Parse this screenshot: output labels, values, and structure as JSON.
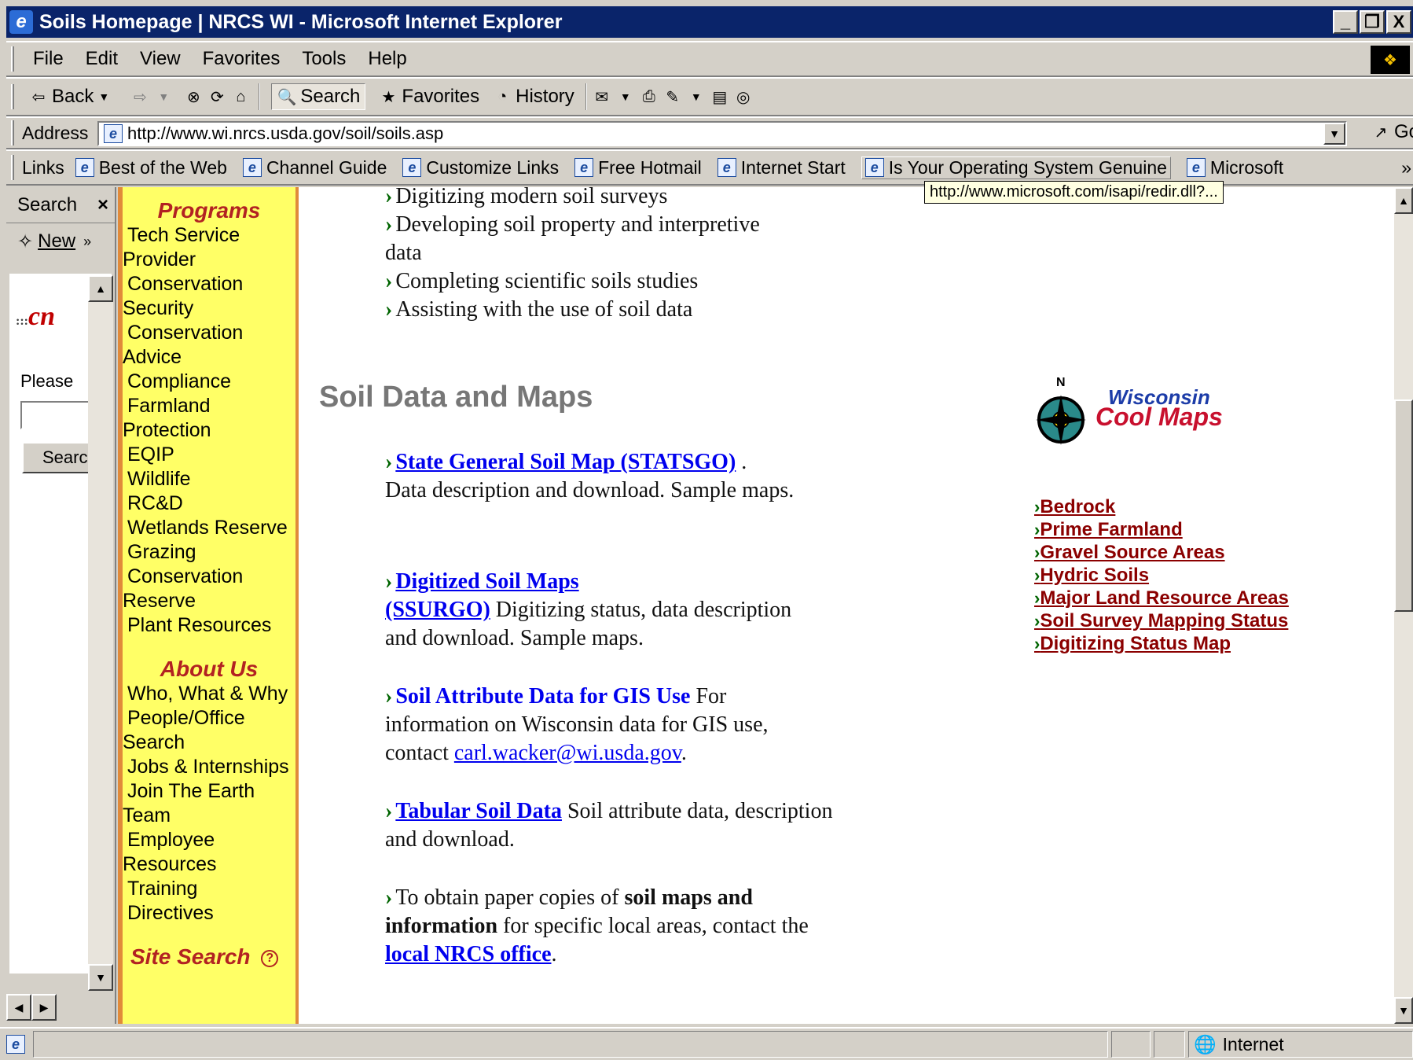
{
  "window": {
    "title": "Soils Homepage | NRCS WI - Microsoft Internet Explorer",
    "controls": [
      "_",
      "▫",
      "X"
    ]
  },
  "menu": [
    "File",
    "Edit",
    "View",
    "Favorites",
    "Tools",
    "Help"
  ],
  "toolbar": {
    "back": "Back",
    "search": "Search",
    "favorites": "Favorites",
    "history": "History"
  },
  "address": {
    "label": "Address",
    "url": "http://www.wi.nrcs.usda.gov/soil/soils.asp",
    "go": "Go"
  },
  "links": {
    "label": "Links",
    "items": [
      "Best of the Web",
      "Channel Guide",
      "Customize Links",
      "Free Hotmail",
      "Internet Start",
      "Is Your Operating System Genuine",
      "Microsoft"
    ],
    "more": "»"
  },
  "tooltip": "http://www.microsoft.com/isapi/redir.dll?...",
  "explorer": {
    "title": "Search",
    "close": "×",
    "new": "New",
    "more": "»",
    "logo": "cn",
    "please": "Please",
    "button": "Searc"
  },
  "nav": {
    "programs_title": "Programs",
    "programs": [
      "Tech Service",
      "Provider",
      "Conservation",
      "Security",
      "Conservation",
      "Advice",
      "Compliance",
      "Farmland",
      "Protection",
      "EQIP",
      "Wildlife",
      "RC&D",
      "Wetlands Reserve",
      "Grazing",
      "Conservation",
      "Reserve",
      "Plant Resources"
    ],
    "about_title": "About Us",
    "about": [
      "Who, What & Why",
      "People/Office",
      "Search",
      "Jobs & Internships",
      "Join The Earth",
      "Team",
      "Employee",
      "Resources",
      "Training",
      "Directives"
    ],
    "site_search": "Site Search",
    "help_icon": "?"
  },
  "main": {
    "bullets": [
      "Digitizing modern soil surveys",
      "Developing soil property and interpretive",
      "data",
      "Completing scientific soils studies",
      "Assisting with the use of soil data"
    ],
    "heading": "Soil Data and Maps",
    "statsgo_link": "State General Soil Map (STATSGO)",
    "statsgo_dot": ".",
    "statsgo_desc": "Data description and download. Sample maps.",
    "ssurgo_link1": "Digitized Soil Maps",
    "ssurgo_link2": "(SSURGO)",
    "ssurgo_desc": "Digitizing status, data description and download.  Sample maps.",
    "gis_link": "Soil Attribute Data for GIS Use",
    "gis_desc": "For information on Wisconsin data for GIS use, contact",
    "gis_email": "carl.wacker@wi.usda.gov",
    "gis_end": ".",
    "tab_link": "Tabular Soil Data",
    "tab_desc": "Soil attribute data, description and download.",
    "paper1": "To obtain paper copies of",
    "paper_bold1": "soil maps and",
    "paper_bold2": "information",
    "paper2": "for specific local areas, contact",
    "paper3": "the",
    "local_link": "local NRCS office",
    "paper_end": "."
  },
  "right": {
    "logo_n": "N",
    "logo_top": "Wisconsin",
    "logo_bottom": "Cool Maps",
    "links": [
      "Bedrock",
      "Prime Farmland",
      "Gravel Source Areas",
      "Hydric Soils",
      "Major Land Resource Areas",
      "Soil Survey Mapping Status",
      "Digitizing Status Map"
    ]
  },
  "status": {
    "zone": "Internet"
  }
}
